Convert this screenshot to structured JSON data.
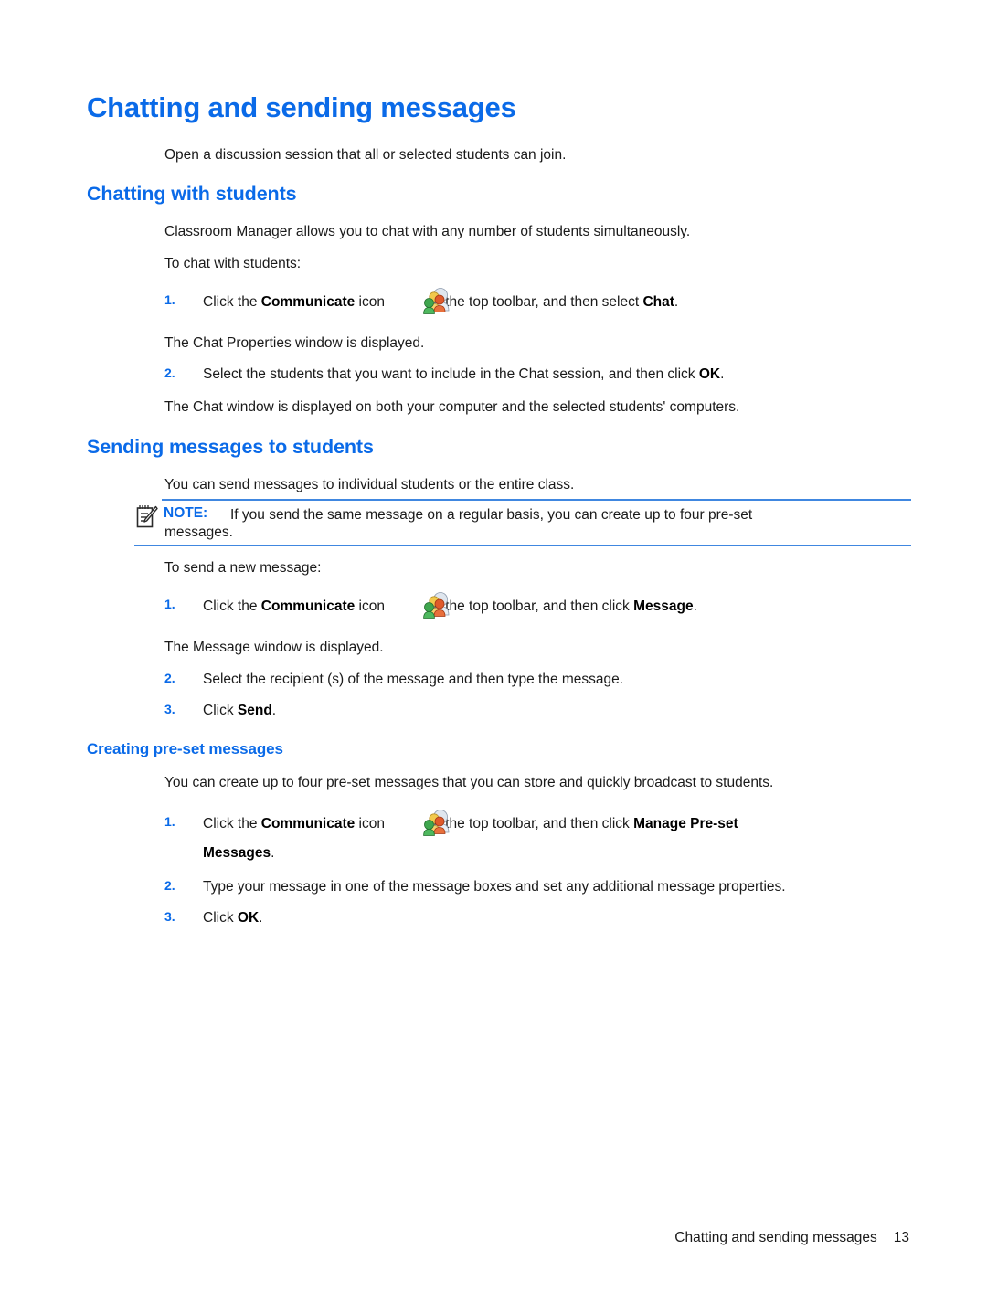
{
  "document": {
    "title": "Chatting and sending messages",
    "intro": "Open a discussion session that all or selected students can join."
  },
  "sections": {
    "chatting_with_students": {
      "heading": "Chatting with students",
      "para1": "Classroom Manager allows you to chat with any number of students simultaneously.",
      "para2": "To chat with students:",
      "steps": [
        {
          "num": "1.",
          "text_before": "Click the ",
          "bold1": "Communicate",
          "text_mid": " icon ",
          "icon": "communicate-people-icon",
          "text_after": " on the top toolbar, and then select ",
          "bold2": "Chat",
          "text_end": "."
        },
        {
          "num": "2.",
          "text_before": "Select the students that you want to include in the Chat session, and then click ",
          "bold1": "OK",
          "text_end": "."
        }
      ],
      "result1": "The Chat Properties window is displayed.",
      "result2": "The Chat window is displayed on both your computer and the selected students' computers."
    },
    "sending_messages": {
      "heading": "Sending messages to students",
      "para1": "You can send messages to individual students or the entire class.",
      "note": {
        "icon": "note-pad-pencil-icon",
        "label": "NOTE:",
        "line1": "If you send the same message on a regular basis, you can create up to four pre-set",
        "line2": "messages."
      },
      "para2": "To send a new message:",
      "steps": [
        {
          "num": "1.",
          "text_before": "Click the ",
          "bold1": "Communicate",
          "text_mid": " icon ",
          "icon": "communicate-people-icon",
          "text_after": " on the top toolbar, and then click ",
          "bold2": "Message",
          "text_end": "."
        },
        {
          "num": "2.",
          "text_before": "Select the recipient (s) of the message and then type the message.",
          "bold1": "",
          "text_end": ""
        },
        {
          "num": "3.",
          "text_before": "Click ",
          "bold1": "Send",
          "text_end": "."
        }
      ],
      "result1": "The Message window is displayed."
    },
    "creating_preset": {
      "heading": "Creating pre-set messages",
      "para1": "You can create up to four pre-set messages that you can store and quickly broadcast to students.",
      "steps": [
        {
          "num": "1.",
          "text_before": "Click the ",
          "bold1": "Communicate",
          "text_mid": " icon ",
          "icon": "communicate-people-icon",
          "text_after": " on the top toolbar, and then click ",
          "bold2": "Manage Pre-set",
          "bold3": "Messages",
          "text_end": "."
        },
        {
          "num": "2.",
          "text_before": "Type your message in one of the message boxes and set any additional message properties.",
          "bold1": "",
          "text_end": ""
        },
        {
          "num": "3.",
          "text_before": "Click ",
          "bold1": "OK",
          "text_end": "."
        }
      ]
    }
  },
  "footer": {
    "chapter": "Chatting and sending messages",
    "page_number": "13"
  },
  "colors": {
    "heading_blue": "#0a6ae8",
    "rule_blue": "#4087e0",
    "body_text": "#1a1a1a"
  }
}
